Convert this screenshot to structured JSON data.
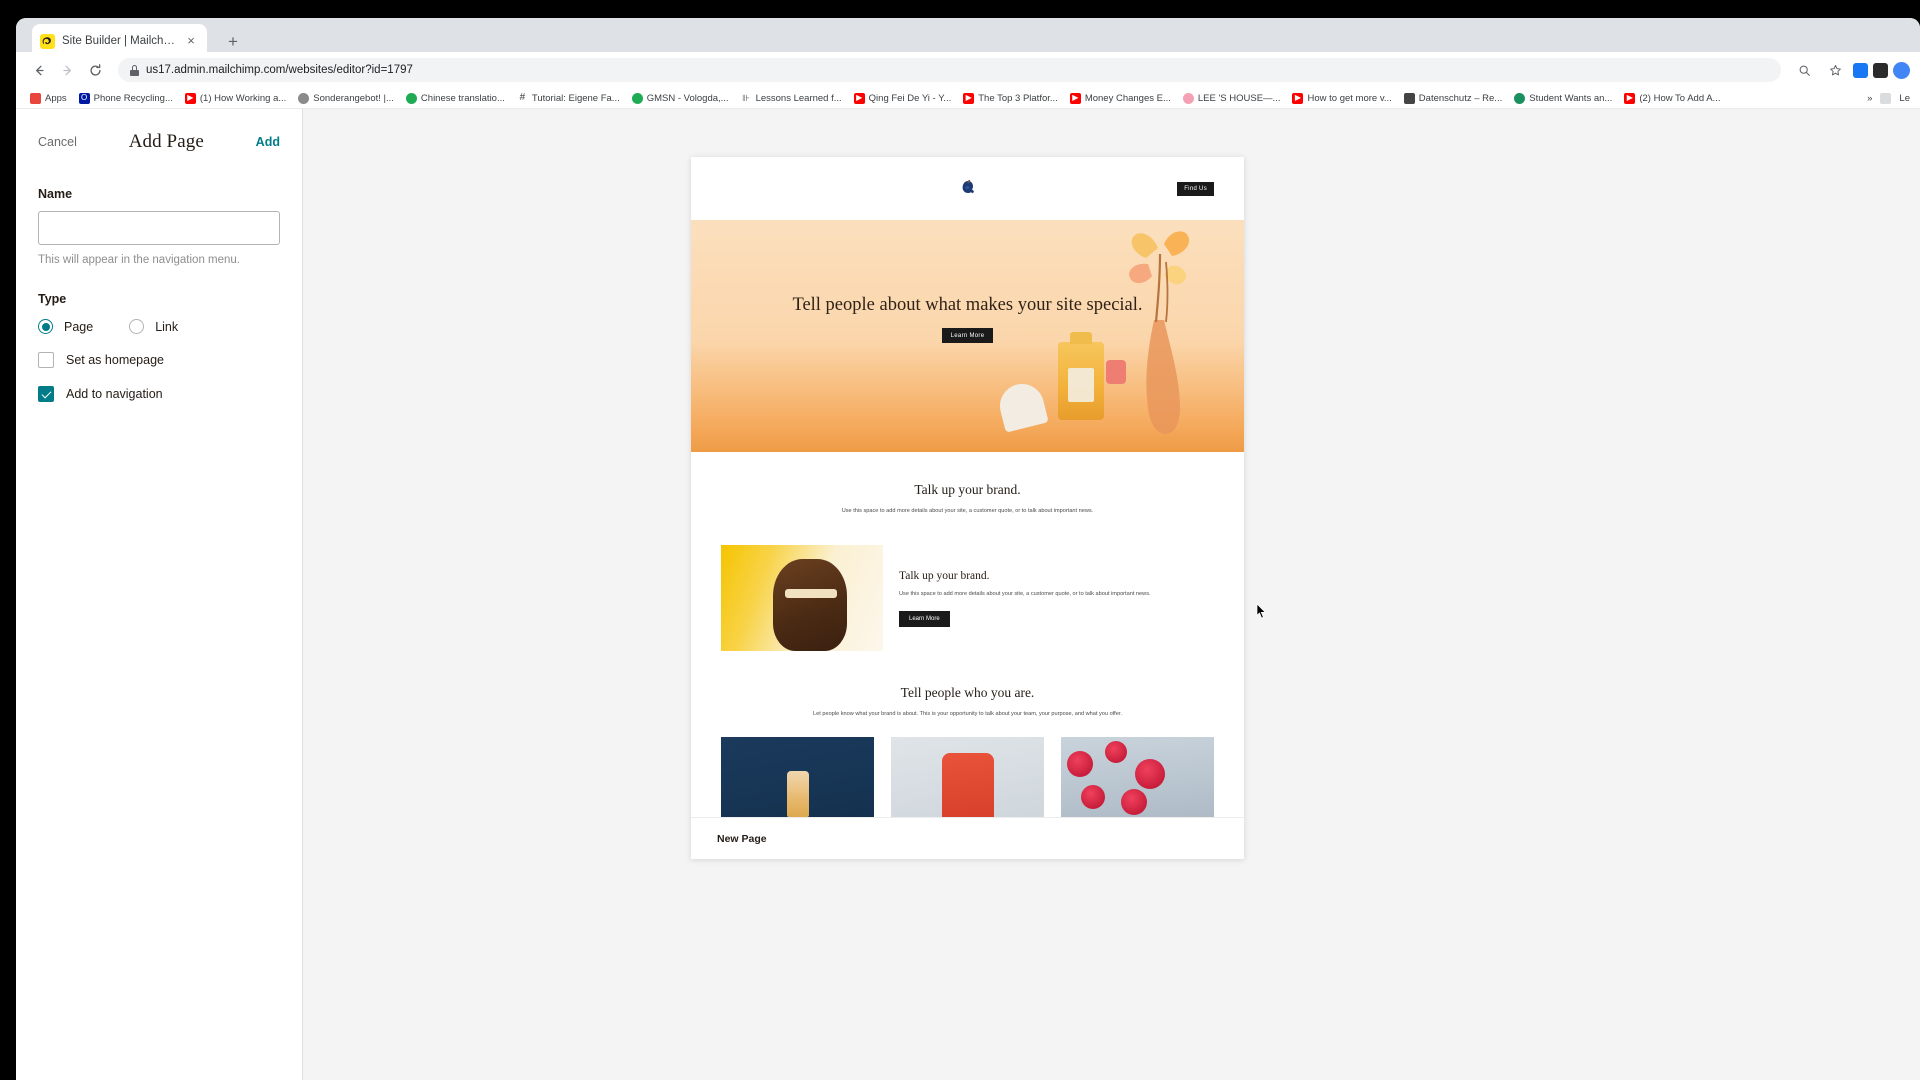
{
  "browser": {
    "tab": {
      "title": "Site Builder | Mailchimp",
      "favicon": "mailchimp-icon",
      "close_label": "×"
    },
    "new_tab_label": "+",
    "nav": {
      "back": "←",
      "forward": "→",
      "reload": "↻"
    },
    "omnibox": {
      "url": "us17.admin.mailchimp.com/websites/editor?id=1797",
      "lock_icon": "lock-icon"
    },
    "toolbar_right": [
      "zoom-icon",
      "star-icon",
      "facebook-extension-icon",
      "pin-extension-icon",
      "profile-avatar"
    ],
    "bookmarks": [
      {
        "label": "Apps",
        "icon": "apps-grid-icon",
        "color": "#e8453c"
      },
      {
        "label": "Phone Recycling...",
        "icon": "o2-icon",
        "color": "#0019a5"
      },
      {
        "label": "(1) How Working a...",
        "icon": "youtube-icon",
        "color": "#ff0000"
      },
      {
        "label": "Sonderangebot! |...",
        "icon": "globe-icon",
        "color": "#8a8a8a"
      },
      {
        "label": "Chinese translatio...",
        "icon": "circle-icon",
        "color": "#1fab54"
      },
      {
        "label": "Tutorial: Eigene Fa...",
        "icon": "hash-icon",
        "color": "#3c4043"
      },
      {
        "label": "GMSN - Vologda,...",
        "icon": "circle-icon",
        "color": "#1fab54"
      },
      {
        "label": "Lessons Learned f...",
        "icon": "chart-icon",
        "color": "#5f6368"
      },
      {
        "label": "Qing Fei De Yi - Y...",
        "icon": "youtube-icon",
        "color": "#ff0000"
      },
      {
        "label": "The Top 3 Platfor...",
        "icon": "youtube-icon",
        "color": "#ff0000"
      },
      {
        "label": "Money Changes E...",
        "icon": "youtube-icon",
        "color": "#ff0000"
      },
      {
        "label": "LEE 'S HOUSE—...",
        "icon": "pink-icon",
        "color": "#f4a0b5"
      },
      {
        "label": "How to get more v...",
        "icon": "youtube-icon",
        "color": "#ff0000"
      },
      {
        "label": "Datenschutz – Re...",
        "icon": "image-icon",
        "color": "#444444"
      },
      {
        "label": "Student Wants an...",
        "icon": "circle-icon",
        "color": "#1a8f5f"
      },
      {
        "label": "(2) How To Add A...",
        "icon": "youtube-icon",
        "color": "#ff0000"
      }
    ],
    "bookmarks_overflow": {
      "more_label": "»",
      "reading_list": "Le"
    }
  },
  "panel": {
    "cancel_label": "Cancel",
    "title": "Add Page",
    "add_label": "Add",
    "name_label": "Name",
    "name_value": "",
    "name_placeholder": "",
    "name_hint": "This will appear in the navigation menu.",
    "type_label": "Type",
    "type_options": [
      {
        "label": "Page",
        "selected": true
      },
      {
        "label": "Link",
        "selected": false
      }
    ],
    "checkboxes": [
      {
        "label": "Set as homepage",
        "checked": false
      },
      {
        "label": "Add to navigation",
        "checked": true
      }
    ]
  },
  "preview": {
    "header": {
      "logo": "site-logo-icon",
      "find_us_label": "Find Us"
    },
    "hero": {
      "heading": "Tell people about what makes your site special.",
      "button_label": "Learn More"
    },
    "section_brand": {
      "heading": "Talk up your brand.",
      "body": "Use this space to add more details about your site, a customer quote, or to talk about important news."
    },
    "split_section": {
      "heading": "Talk up your brand.",
      "body": "Use this space to add more details about your site, a customer quote, or to talk about important news.",
      "button_label": "Learn More",
      "image": "woman-with-gold-makeup-photo"
    },
    "section_about": {
      "heading": "Tell people who you are.",
      "body": "Let people know what your brand is about. This is your opportunity to talk about your team, your purpose, and what you offer."
    },
    "cards": [
      {
        "image": "perfume-bottle-on-navy-photo"
      },
      {
        "image": "person-in-red-suit-photo"
      },
      {
        "image": "red-gerbera-flowers-photo"
      }
    ],
    "footer_bar": {
      "page_name": "New Page"
    }
  },
  "colors": {
    "accent": "#007c89",
    "hero_gradient_top": "#fbdfbd",
    "hero_gradient_bottom": "#ef9b45",
    "dark_button": "#1a1a1a",
    "chrome_bg": "#dee1e6"
  }
}
